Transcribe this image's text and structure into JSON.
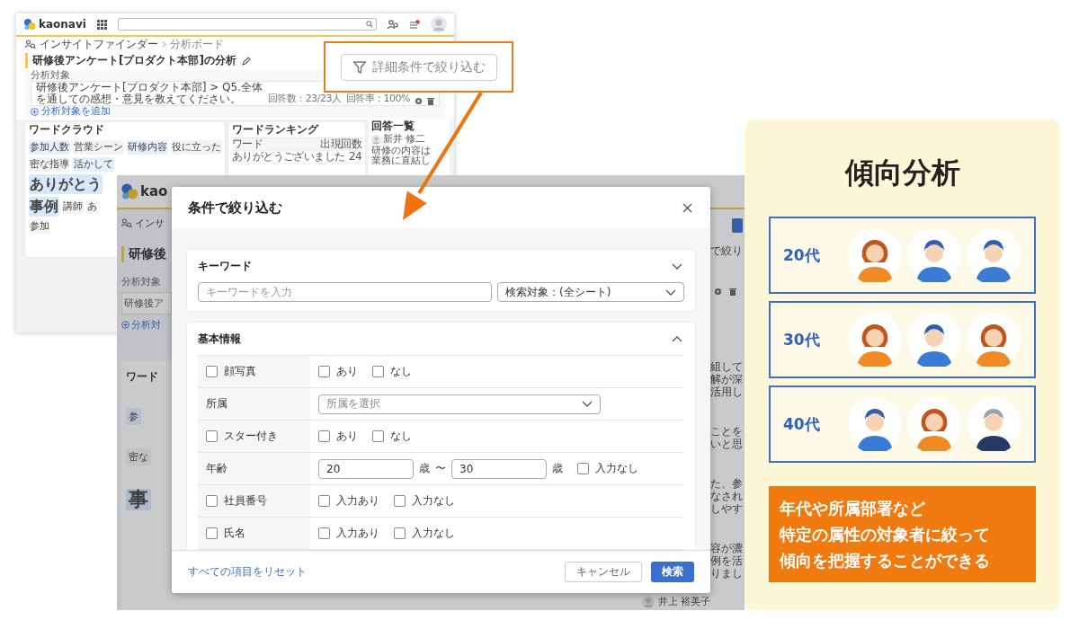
{
  "analysis_window": {
    "logo": "kaonavi",
    "breadcrumb": [
      "インサイトファインダー",
      "分析ボード"
    ],
    "title": "研修後アンケート[プロダクト本部]の分析",
    "target_label": "分析対象",
    "target": "研修後アンケート[プロダクト本部] > Q5.全体を通しての感想・意見を教えてください。",
    "stats": [
      "回答数：23/23人",
      "回答率：100%"
    ],
    "add_target": "分析対象を追加",
    "word_cloud": {
      "title": "ワードクラウド",
      "top_words": [
        {
          "text": "参加人数",
          "kind": "accent"
        },
        {
          "text": "営業シーン",
          "kind": "plain"
        },
        {
          "text": "研修内容",
          "kind": "accent"
        },
        {
          "text": "役に立った",
          "kind": "plain"
        }
      ],
      "side_words": [
        {
          "text": "密な指導",
          "kind": "plain"
        },
        {
          "text": "活かして",
          "kind": "accent"
        },
        {
          "text": "ありがとう",
          "kind": "strong"
        },
        {
          "text": "事例",
          "kind": "strong"
        },
        {
          "text": "講師",
          "kind": "plain"
        },
        {
          "text": "あ",
          "kind": "plain"
        },
        {
          "text": "参加",
          "kind": "plain"
        }
      ]
    },
    "ranking": {
      "title": "ワードランキング",
      "columns": [
        "ワード",
        "出現回数"
      ],
      "rows": [
        [
          "ありがとうございました",
          "24"
        ]
      ]
    },
    "answers": {
      "title": "回答一覧",
      "name": "新井 修二",
      "text": "研修の内容は業務に直結し"
    }
  },
  "filter_callout": {
    "label": "詳細条件で絞り込む"
  },
  "back_window": {
    "logo": "kao",
    "breadcrumb": "インサ",
    "title": "研修後",
    "target_label": "分析対象",
    "target": "研修後ア",
    "add_target": "分析対",
    "card_title": "ワード",
    "words": [
      {
        "text": "参",
        "kind": "accent"
      },
      {
        "text": "密な",
        "kind": "plain"
      },
      {
        "text": "事",
        "kind": "strong"
      }
    ],
    "filter_label": "で絞り",
    "answer_fragments": [
      [
        "組して",
        "解が深",
        "活用し"
      ],
      [
        "ことを",
        "いと思"
      ],
      [
        "た、参",
        "なされ",
        "しやす"
      ],
      [
        "容が濃",
        "例を活",
        "りまし"
      ]
    ],
    "answer_name": "井上 裕美子"
  },
  "dialog": {
    "title": "条件で絞り込む",
    "sections": [
      {
        "kind": "keyword",
        "title": "キーワード",
        "expanded": false,
        "placeholder": "キーワードを入力",
        "scope": "検索対象：(全シート)"
      },
      {
        "kind": "fields",
        "title": "基本情報",
        "expanded": true,
        "rows": [
          {
            "kind": "options",
            "label": "顔写真",
            "checked": false,
            "options": [
              {
                "label": "あり",
                "checked": false
              },
              {
                "label": "なし",
                "checked": false
              }
            ]
          },
          {
            "kind": "select",
            "label": "所属",
            "placeholder": "所属を選択"
          },
          {
            "kind": "options",
            "label": "スター付き",
            "checked": false,
            "options": [
              {
                "label": "あり",
                "checked": false
              },
              {
                "label": "なし",
                "checked": false
              }
            ]
          },
          {
            "kind": "range",
            "label": "年齢",
            "from": "20",
            "unit_from": "歳",
            "separator": "〜",
            "to": "30",
            "unit_to": "歳",
            "none_option": {
              "label": "入力なし",
              "checked": false
            }
          },
          {
            "kind": "options",
            "label": "社員番号",
            "checked": false,
            "options": [
              {
                "label": "入力あり",
                "checked": false
              },
              {
                "label": "入力なし",
                "checked": false
              }
            ]
          },
          {
            "kind": "options",
            "label": "氏名",
            "checked": false,
            "options": [
              {
                "label": "入力あり",
                "checked": false
              },
              {
                "label": "入力なし",
                "checked": false
              }
            ]
          }
        ]
      }
    ],
    "reset": "すべての項目をリセット",
    "cancel": "キャンセル",
    "submit": "検索"
  },
  "promo": {
    "title": "傾向分析",
    "groups": [
      {
        "label": "20代",
        "avatars": [
          {
            "kind": "female"
          },
          {
            "kind": "male"
          },
          {
            "kind": "male"
          }
        ]
      },
      {
        "label": "30代",
        "avatars": [
          {
            "kind": "female"
          },
          {
            "kind": "male"
          },
          {
            "kind": "female"
          }
        ]
      },
      {
        "label": "40代",
        "avatars": [
          {
            "kind": "male"
          },
          {
            "kind": "female"
          },
          {
            "kind": "senior"
          }
        ]
      }
    ],
    "note_lines": [
      "年代や所属部署など",
      "特定の属性の対象者に絞って",
      "傾向を把握することができる"
    ]
  }
}
